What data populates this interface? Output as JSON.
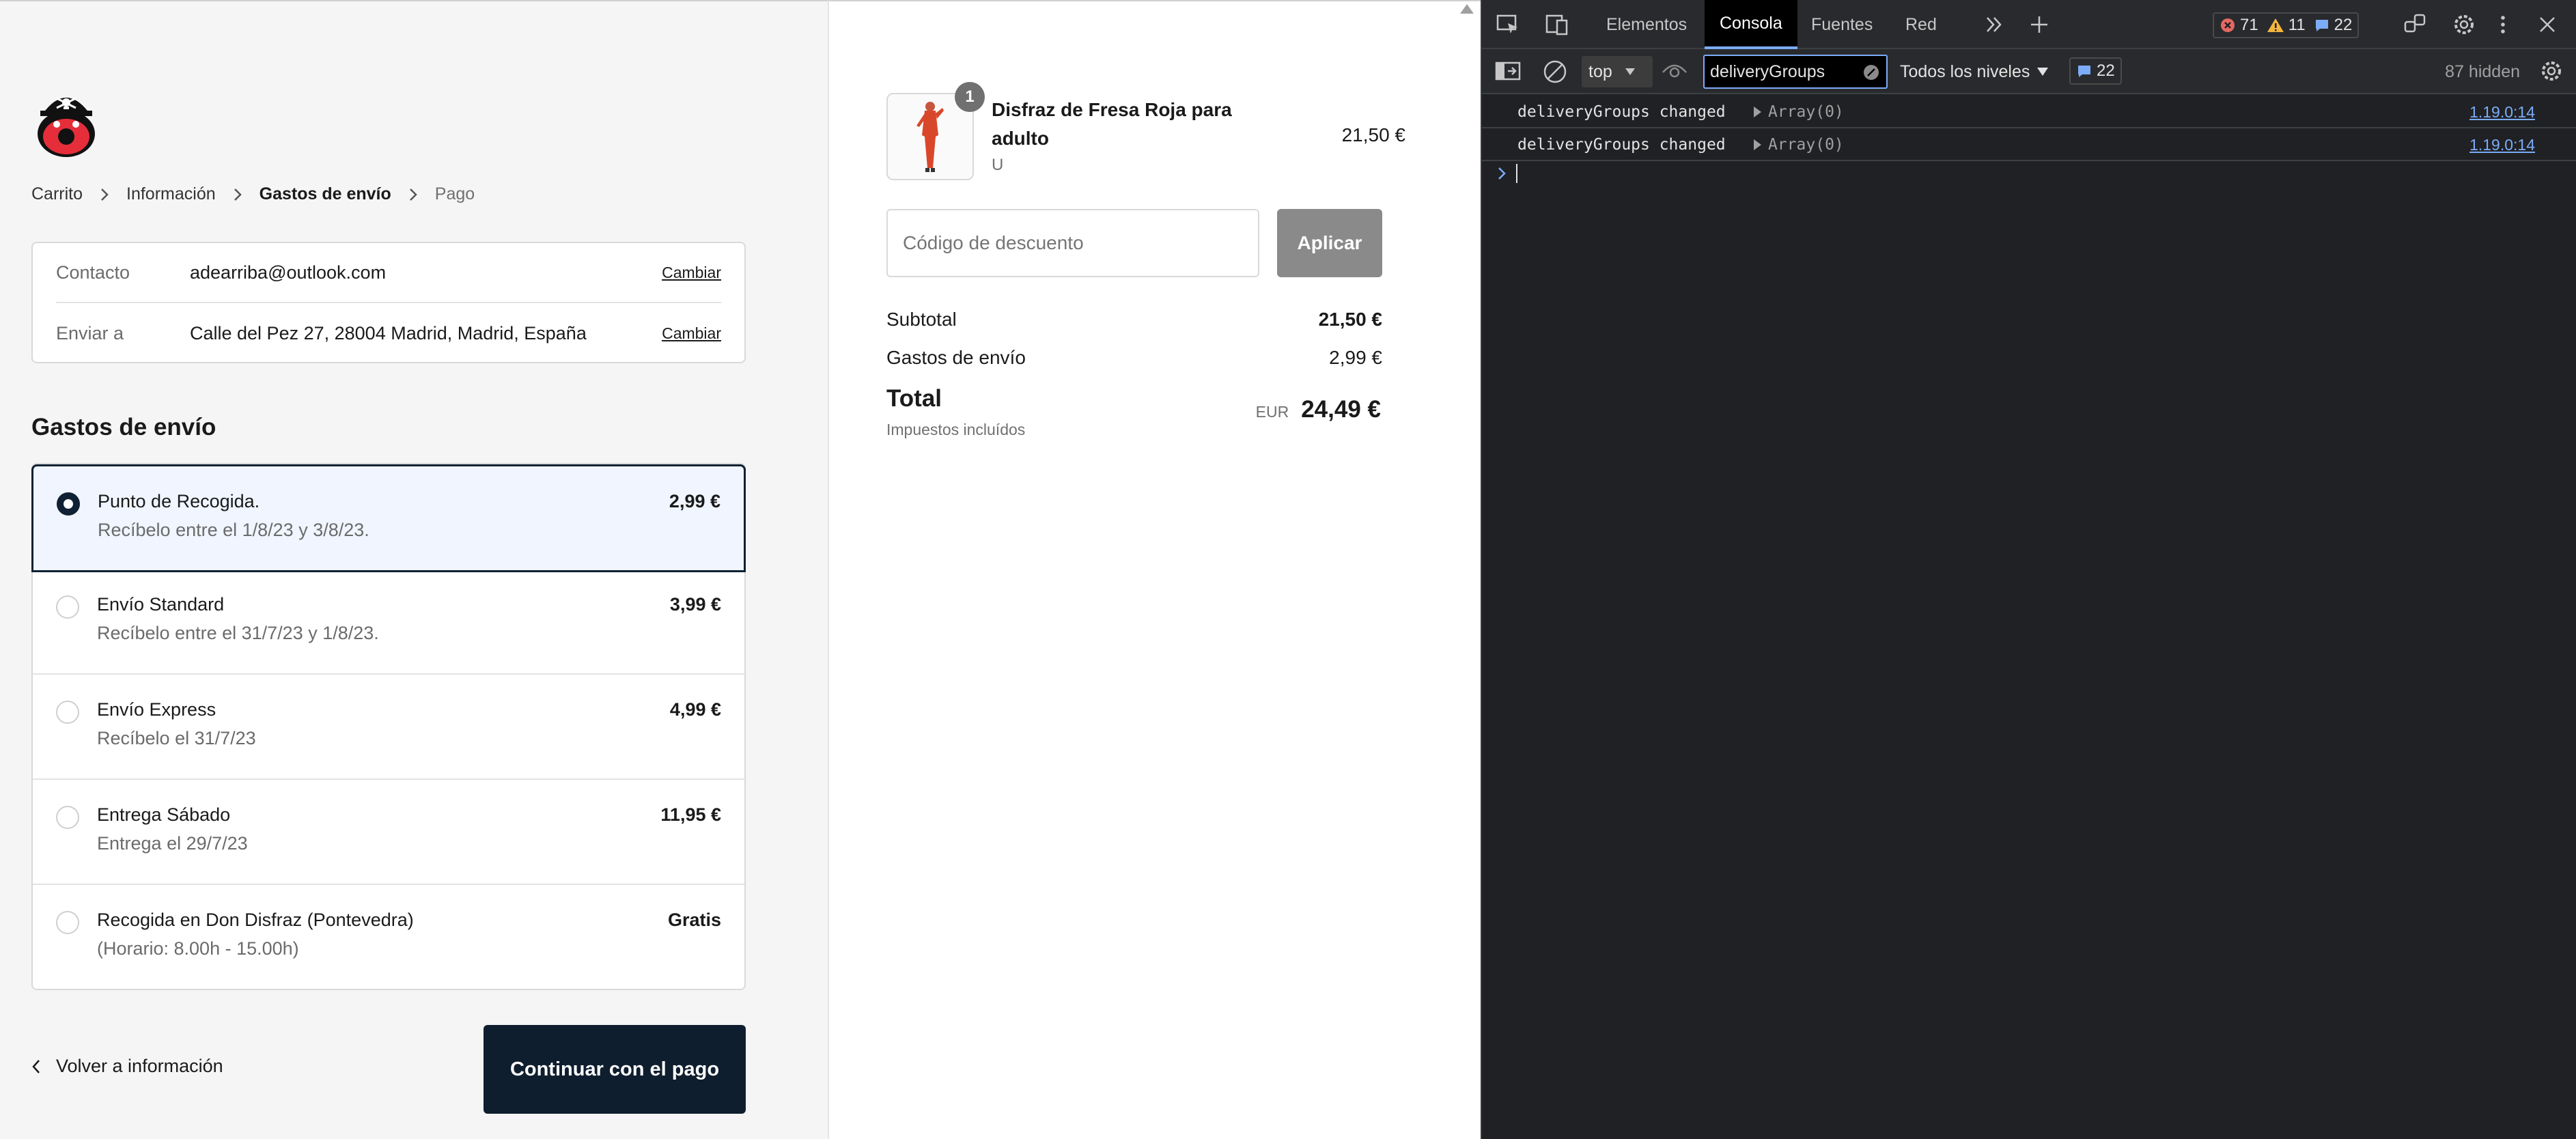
{
  "checkout": {
    "logo_icon": "pirate-skull-logo",
    "breadcrumb": {
      "cart": "Carrito",
      "info": "Información",
      "shipping": "Gastos de envío",
      "payment": "Pago"
    },
    "contact": {
      "label": "Contacto",
      "value": "adearriba@outlook.com",
      "change": "Cambiar"
    },
    "ship_to": {
      "label": "Enviar a",
      "value": "Calle del Pez 27, 28004 Madrid, Madrid, España",
      "change": "Cambiar"
    },
    "section_title": "Gastos de envío",
    "options": [
      {
        "name": "Punto de Recogida.",
        "sub": "Recíbelo entre el 1/8/23 y 3/8/23.",
        "price": "2,99 €",
        "selected": true
      },
      {
        "name": "Envío Standard",
        "sub": "Recíbelo entre el 31/7/23 y 1/8/23.",
        "price": "3,99 €",
        "selected": false
      },
      {
        "name": "Envío Express",
        "sub": "Recíbelo el 31/7/23",
        "price": "4,99 €",
        "selected": false
      },
      {
        "name": "Entrega Sábado",
        "sub": "Entrega el 29/7/23",
        "price": "11,95 €",
        "selected": false
      },
      {
        "name": "Recogida en Don Disfraz (Pontevedra)",
        "sub": "(Horario: 8.00h - 15.00h)",
        "price": "Gratis",
        "selected": false
      }
    ],
    "back_label": "Volver a información",
    "continue_label": "Continuar con el pago"
  },
  "summary": {
    "product": {
      "quantity": "1",
      "name": "Disfraz de Fresa Roja para adulto",
      "variant": "U",
      "price": "21,50 €"
    },
    "discount_placeholder": "Código de descuento",
    "apply_label": "Aplicar",
    "subtotal_label": "Subtotal",
    "subtotal_value": "21,50 €",
    "shipping_label": "Gastos de envío",
    "shipping_value": "2,99 €",
    "total_label": "Total",
    "tax_note": "Impuestos incluídos",
    "currency": "EUR",
    "total_value": "24,49 €"
  },
  "devtools": {
    "tabs": [
      "Elementos",
      "Consola",
      "Fuentes",
      "Red"
    ],
    "active_tab": "Consola",
    "errors": "71",
    "warnings": "11",
    "messages": "22",
    "context": "top",
    "filter": "deliveryGroups",
    "levels": "Todos los niveles",
    "issues": "22",
    "hidden": "87 hidden",
    "logs": [
      {
        "msg": "deliveryGroups changed",
        "value": "Array(0)",
        "source": "1.19.0:14"
      },
      {
        "msg": "deliveryGroups changed",
        "value": "Array(0)",
        "source": "1.19.0:14"
      }
    ]
  },
  "colors": {
    "primary_dark": "#0f1e2e",
    "selected_bg": "#f0f5ff",
    "devtools_bg": "#202124",
    "link_blue": "#7cacf8",
    "error_red": "#e46962",
    "warning_yellow": "#f2b63d"
  }
}
